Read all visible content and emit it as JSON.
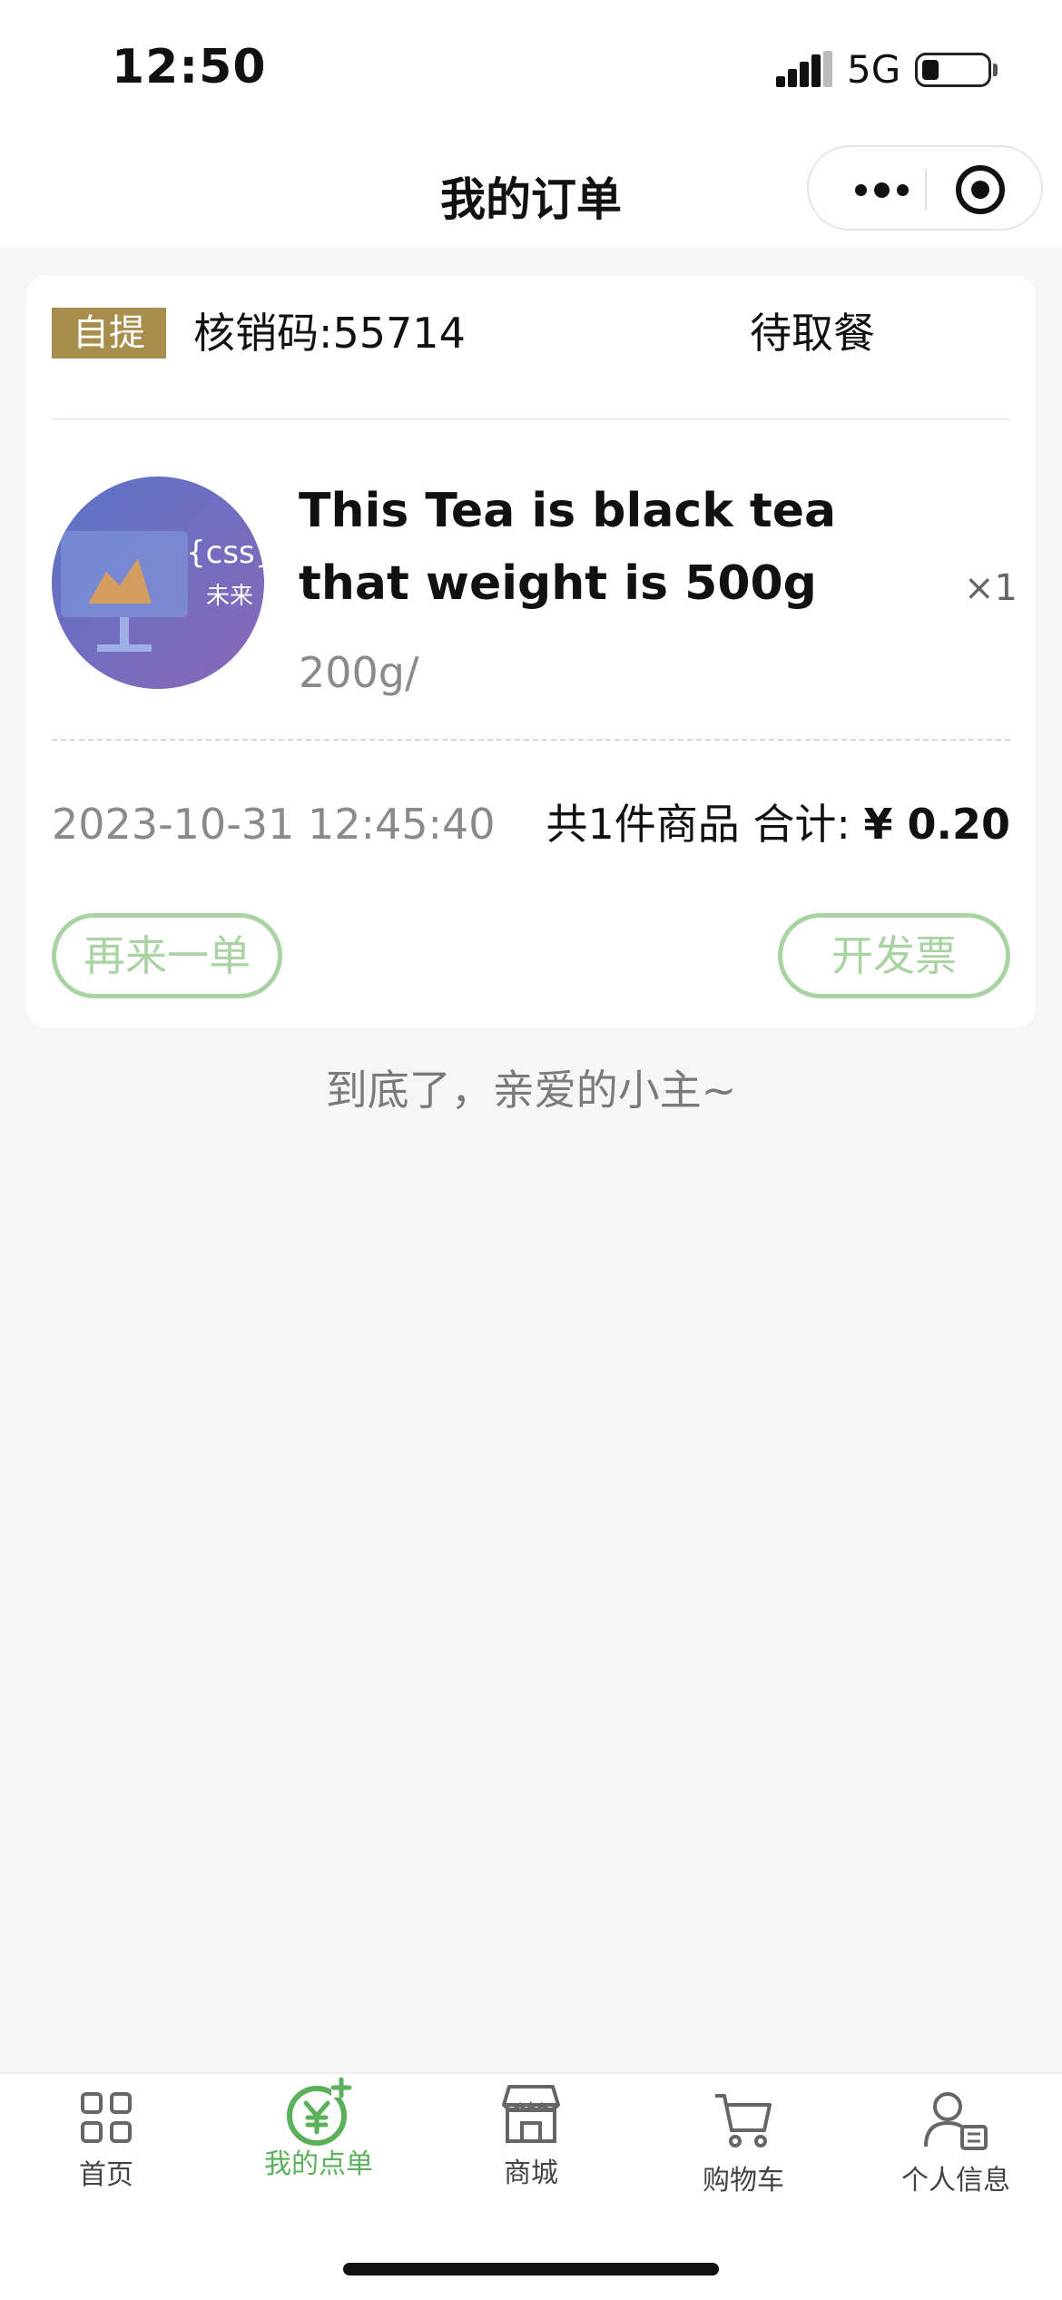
{
  "status_bar": {
    "time": "12:50",
    "network": "5G"
  },
  "nav": {
    "title": "我的订单"
  },
  "order": {
    "tag": "自提",
    "verify_code": "核销码:55714",
    "status": "待取餐",
    "product": {
      "image_text_1": "{css}",
      "image_text_2": "未来",
      "name": "This Tea is black tea that weight is 500g",
      "qty": "×1",
      "spec": "200g/"
    },
    "time": "2023-10-31 12:45:40",
    "count_text": "共1件商品",
    "total_label": "合计:",
    "total_amount": "¥ 0.20",
    "reorder_label": "再来一单",
    "invoice_label": "开发票"
  },
  "end_hint": "到底了，亲爱的小主~",
  "tabbar": {
    "items": [
      {
        "label": "首页",
        "icon": "grid-icon"
      },
      {
        "label": "我的点单",
        "icon": "yen-add-icon"
      },
      {
        "label": "商城",
        "icon": "store-icon"
      },
      {
        "label": "购物车",
        "icon": "cart-icon"
      },
      {
        "label": "个人信息",
        "icon": "profile-card-icon"
      }
    ],
    "active_index": 1
  },
  "colors": {
    "accent_green": "#5bb05a",
    "button_outline_green": "#a9d3a2",
    "pickup_tag": "#a88e4d",
    "background": "#f6f6f6"
  }
}
